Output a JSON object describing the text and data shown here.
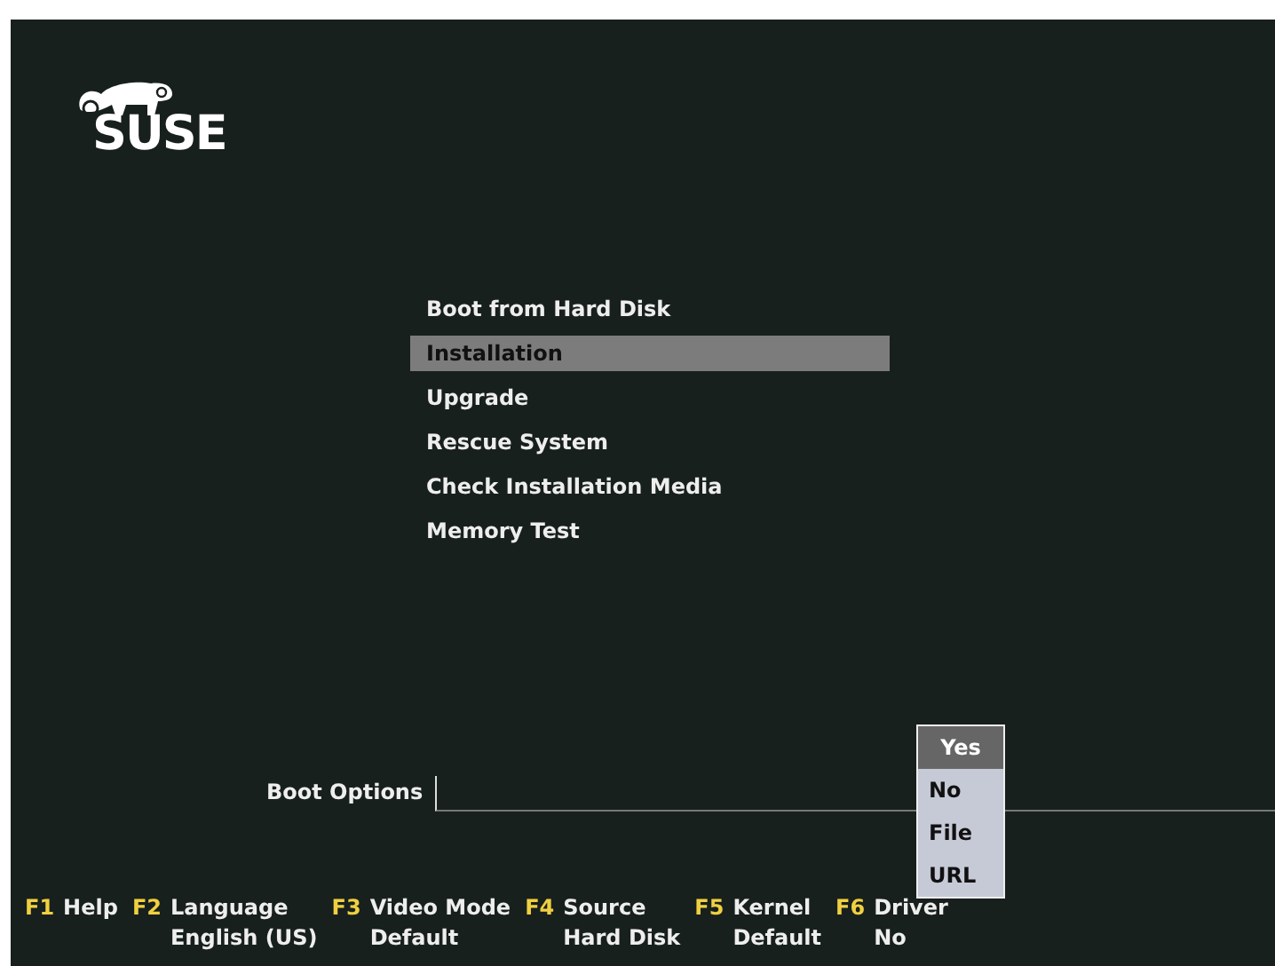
{
  "logo": {
    "text": "SUSE"
  },
  "menu": [
    {
      "label": "Boot from Hard Disk",
      "selected": false
    },
    {
      "label": "Installation",
      "selected": true
    },
    {
      "label": "Upgrade",
      "selected": false
    },
    {
      "label": "Rescue System",
      "selected": false
    },
    {
      "label": "Check Installation Media",
      "selected": false
    },
    {
      "label": "Memory Test",
      "selected": false
    }
  ],
  "boot_options": {
    "label": "Boot Options"
  },
  "driver_dropdown": [
    {
      "label": "Yes",
      "selected": true
    },
    {
      "label": "No",
      "selected": false
    },
    {
      "label": "File",
      "selected": false
    },
    {
      "label": "URL",
      "selected": false
    }
  ],
  "function_keys": [
    {
      "key": "F1",
      "label": "Help"
    },
    {
      "key": "F2",
      "label": "Language",
      "value": "English (US)"
    },
    {
      "key": "F3",
      "label": "Video Mode",
      "value": "Default"
    },
    {
      "key": "F4",
      "label": "Source",
      "value": "Hard Disk"
    },
    {
      "key": "F5",
      "label": "Kernel",
      "value": "Default"
    },
    {
      "key": "F6",
      "label": "Driver",
      "value": "No"
    }
  ]
}
